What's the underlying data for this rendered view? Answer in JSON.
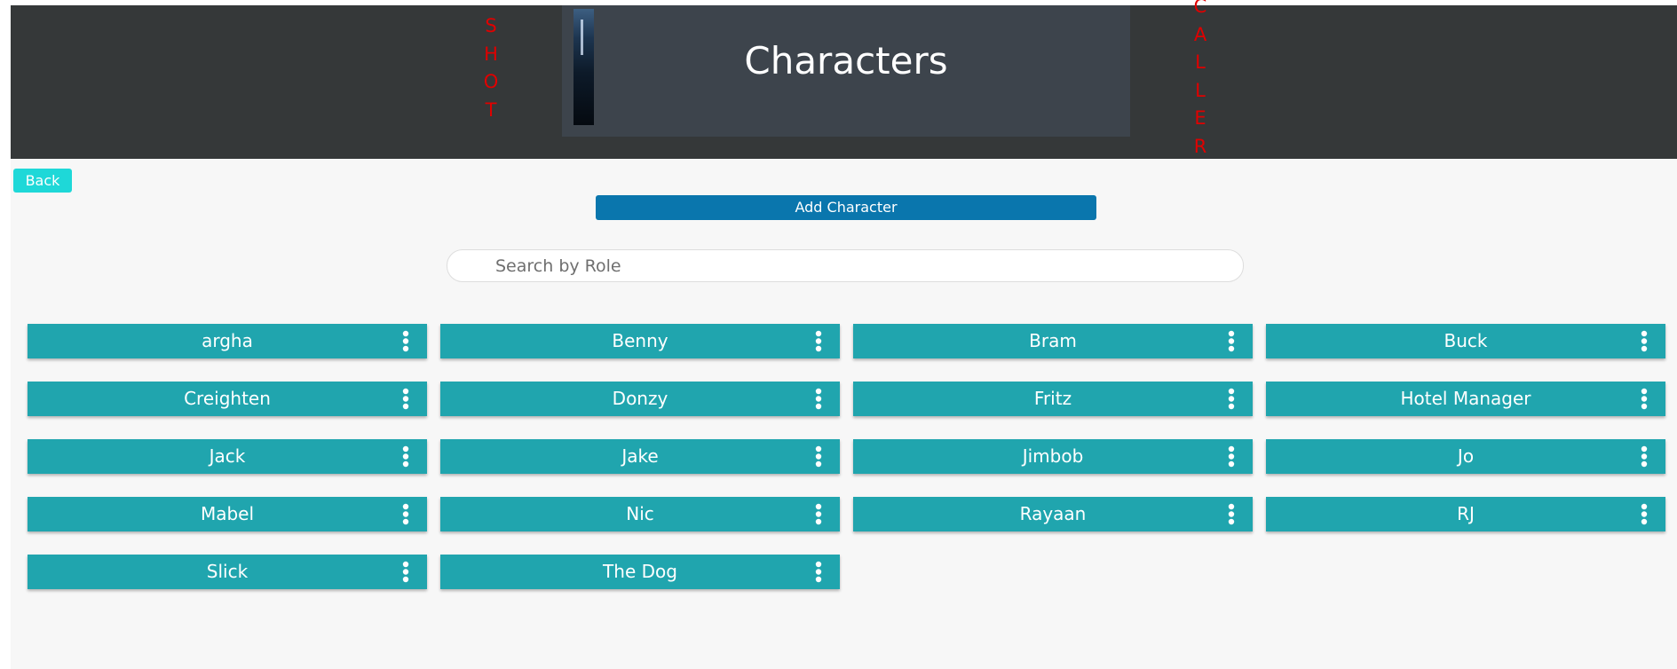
{
  "header": {
    "left_vertical": "S\nH\nO\nT",
    "right_vertical": "C\nA\nL\nL\nE\nR",
    "title": "Characters"
  },
  "buttons": {
    "back": "Back",
    "add_character": "Add Character"
  },
  "search": {
    "placeholder": "Search by Role",
    "value": ""
  },
  "characters": [
    "argha",
    "Benny",
    "Bram",
    "Buck",
    "Creighten",
    "Donzy",
    "Fritz",
    "Hotel Manager",
    "Jack",
    "Jake",
    "Jimbob",
    "Jo",
    "Mabel",
    "Nic",
    "Rayaan",
    "RJ",
    "Slick",
    "The Dog"
  ],
  "icons": {
    "card_menu": "more-vertical-icon",
    "thumbnail": "poster-thumbnail"
  },
  "colors": {
    "header_bg": "#353839",
    "title_panel_bg": "#3d444c",
    "vertical_text": "#e00000",
    "back_button": "#1ed8d8",
    "add_button": "#0a76ad",
    "card_bg": "#20a5ae",
    "page_bg": "#f7f7f7"
  }
}
